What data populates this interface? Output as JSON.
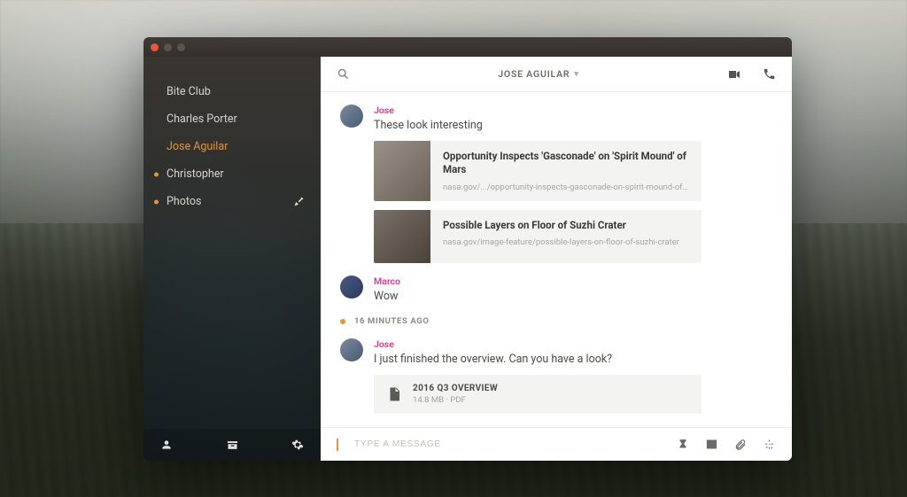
{
  "header": {
    "title": "JOSE AGUILAR"
  },
  "sidebar": {
    "items": [
      {
        "label": "Bite Club",
        "active": false,
        "unread": false
      },
      {
        "label": "Charles Porter",
        "active": false,
        "unread": false
      },
      {
        "label": "Jose Aguilar",
        "active": true,
        "unread": false
      },
      {
        "label": "Christopher",
        "active": false,
        "unread": true
      },
      {
        "label": "Photos",
        "active": false,
        "unread": true,
        "trail_icon": "ping-icon"
      }
    ]
  },
  "messages": [
    {
      "sender": "Jose",
      "text": "These look interesting",
      "links": [
        {
          "title": "Opportunity Inspects 'Gasconade' on 'Spirit Mound' of Mars",
          "url": "nasa.gov/.../opportunity-inspects-gasconade-on-spirit-mound-of-mars"
        },
        {
          "title": "Possible Layers on Floor of Suzhi Crater",
          "url": "nasa.gov/image-feature/possible-layers-on-floor-of-suzhi-crater"
        }
      ]
    },
    {
      "sender": "Marco",
      "text": "Wow"
    }
  ],
  "divider": {
    "label": "16 MINUTES AGO"
  },
  "messages_after": [
    {
      "sender": "Jose",
      "text": "I just finished the overview. Can you have a look?",
      "file": {
        "name": "2016 Q3 OVERVIEW",
        "info": "14.8 MB  ·  PDF"
      }
    }
  ],
  "composer": {
    "placeholder": "TYPE A MESSAGE"
  }
}
